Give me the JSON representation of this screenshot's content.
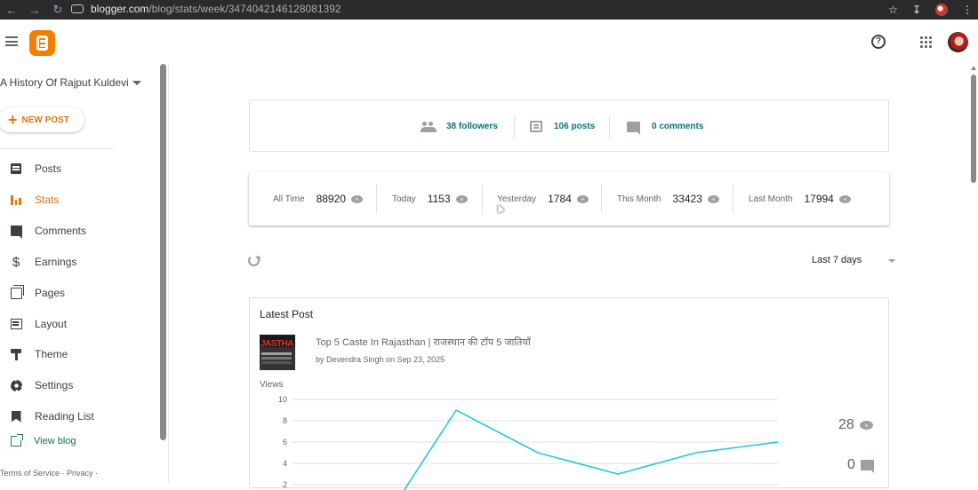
{
  "browser": {
    "url_host": "blogger.com",
    "url_path": "/blog/stats/week/3474042146128081392"
  },
  "sidebar": {
    "blog_title": "A History Of Rajput Kuldevi",
    "new_post_label": "NEW POST",
    "items": [
      {
        "label": "Posts",
        "icon": "posts-icon"
      },
      {
        "label": "Stats",
        "icon": "stats-icon",
        "active": true
      },
      {
        "label": "Comments",
        "icon": "comments-icon"
      },
      {
        "label": "Earnings",
        "icon": "dollar-icon"
      },
      {
        "label": "Pages",
        "icon": "pages-icon"
      },
      {
        "label": "Layout",
        "icon": "layout-icon"
      },
      {
        "label": "Theme",
        "icon": "paint-roller-icon"
      },
      {
        "label": "Settings",
        "icon": "gear-icon"
      },
      {
        "label": "Reading List",
        "icon": "bookmark-icon"
      }
    ],
    "view_blog_label": "View blog",
    "footer": "Terms of Service · Privacy ·"
  },
  "summary": {
    "followers": "38 followers",
    "posts": "106 posts",
    "comments": "0 comments"
  },
  "views": [
    {
      "label": "All Time",
      "value": "88920"
    },
    {
      "label": "Today",
      "value": "1153"
    },
    {
      "label": "Yesterday",
      "value": "1784"
    },
    {
      "label": "This Month",
      "value": "33423"
    },
    {
      "label": "Last Month",
      "value": "17994"
    }
  ],
  "range": {
    "selected": "Last 7 days"
  },
  "latest_post": {
    "section_title": "Latest Post",
    "title": "Top 5 Caste In Rajasthan | राजस्थान की टॉप 5 जातियाँ",
    "byline": "by Devendra Singh on Sep 23, 2025",
    "thumb_text": "JASTHA",
    "views_total": "28",
    "comments_total": "0"
  },
  "chart_data": {
    "type": "line",
    "ylabel": "Views",
    "yticks": [
      2,
      4,
      6,
      8,
      10
    ],
    "ylim": [
      2,
      10
    ],
    "x": [
      0,
      1,
      2,
      3,
      4,
      5,
      6
    ],
    "values": [
      0,
      9,
      5,
      3,
      5,
      6
    ],
    "line_color": "#26c6da",
    "grid": true
  },
  "colors": {
    "accent": "#e8710a",
    "teal_link": "#00796b",
    "brand": "#f57d00"
  }
}
